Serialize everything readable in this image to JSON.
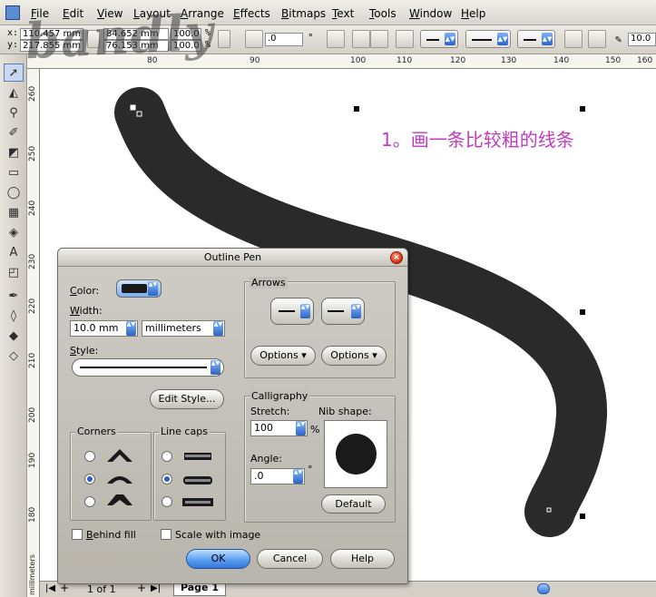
{
  "watermark": "bandly",
  "menu": [
    "File",
    "Edit",
    "View",
    "Layout",
    "Arrange",
    "Effects",
    "Bitmaps",
    "Text",
    "Tools",
    "Window",
    "Help"
  ],
  "propbar": {
    "x_label": "x:",
    "y_label": "y:",
    "x_value": "110.457 mm",
    "y_value": "217.855 mm",
    "w_value": "84.652 mm",
    "h_value": "76.153 mm",
    "scale_x": "100.0",
    "scale_y": "100.0",
    "pct": "%",
    "rotation": ".0",
    "degree": "°",
    "outline_width": "10.0"
  },
  "ruler": {
    "h_ticks": [
      "80",
      "90",
      "100",
      "110",
      "120",
      "130",
      "140",
      "150",
      "160"
    ],
    "v_ticks": [
      "260",
      "250",
      "240",
      "230",
      "220",
      "210",
      "200",
      "190",
      "180"
    ],
    "unit": "millimeters"
  },
  "toolbox": [
    "pick-tool",
    "shape-tool",
    "zoom-tool",
    "freehand-tool",
    "smart-fill-tool",
    "rectangle-tool",
    "ellipse-tool",
    "polygon-tool",
    "basic-shapes-tool",
    "text-tool",
    "interactive-tool",
    "eyedropper-tool",
    "outline-tool",
    "fill-tool",
    "interactive-fill-tool"
  ],
  "canvas": {
    "annotation": "1。画一条比较粗的线条"
  },
  "status": {
    "page_count": "1 of 1",
    "page_tab": "Page 1"
  },
  "dialog": {
    "title": "Outline Pen",
    "color_label": "Color:",
    "color_value": "#1a1a1a",
    "width_label": "Width:",
    "width_value": "10.0 mm",
    "units_value": "millimeters",
    "style_label": "Style:",
    "edit_style": "Edit Style...",
    "arrows_title": "Arrows",
    "options_left": "Options",
    "options_right": "Options",
    "corners_title": "Corners",
    "linecaps_title": "Line caps",
    "calligraphy_title": "Calligraphy",
    "stretch_label": "Stretch:",
    "stretch_value": "100",
    "pct": "%",
    "nib_label": "Nib shape:",
    "angle_label": "Angle:",
    "angle_value": ".0",
    "degree": "°",
    "default_btn": "Default",
    "behind_fill": "Behind fill",
    "scale_with_image": "Scale with image",
    "ok": "OK",
    "cancel": "Cancel",
    "help": "Help"
  }
}
